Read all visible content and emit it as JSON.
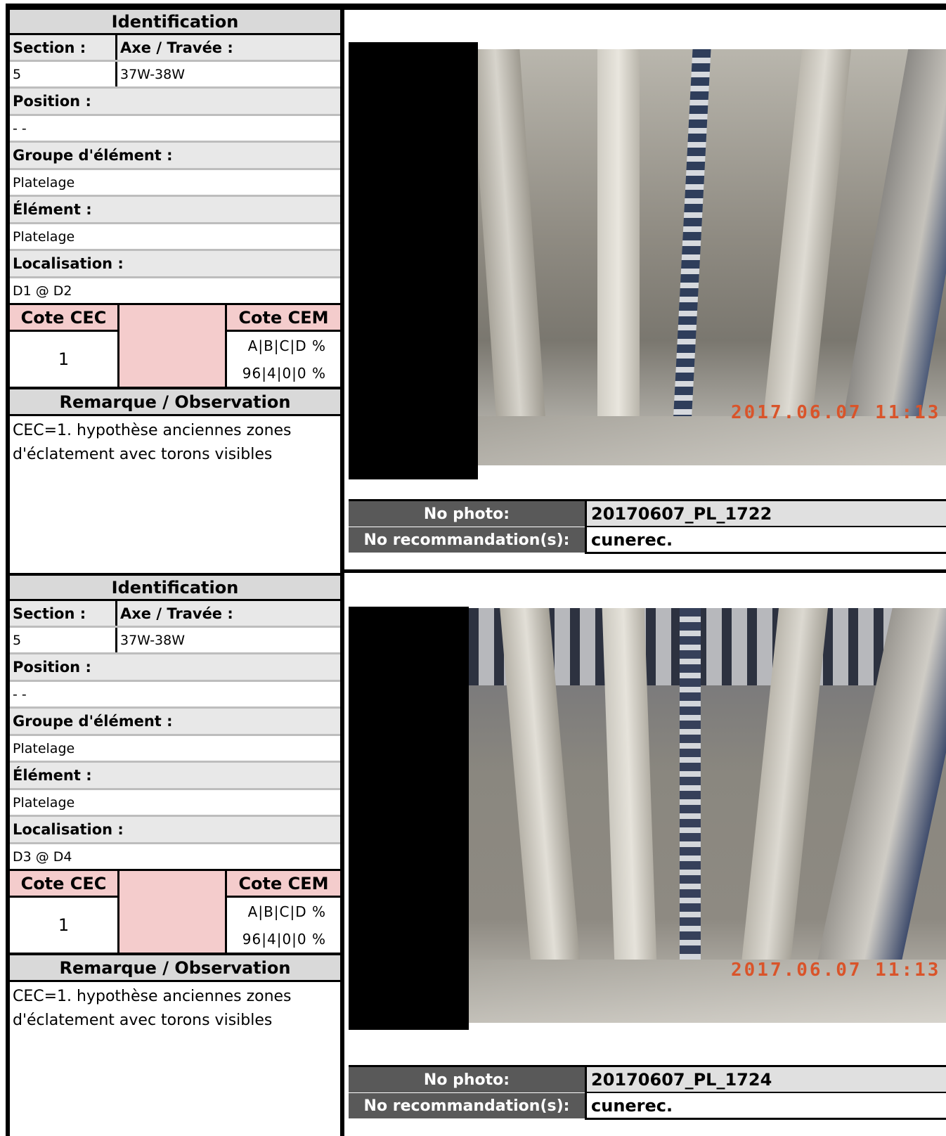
{
  "labels": {
    "identification": "Identification",
    "section": "Section :",
    "axe_travee": "Axe / Travée :",
    "position": "Position :",
    "groupe": "Groupe d'élément :",
    "element": "Élément :",
    "localisation": "Localisation :",
    "cote_cec": "Cote CEC",
    "cote_cem": "Cote CEM",
    "cem_header": "A|B|C|D %",
    "remarque": "Remarque / Observation",
    "no_photo": "No photo:",
    "no_recommandation": "No recommandation(s):"
  },
  "records": [
    {
      "section": "5",
      "axe": "37W-38W",
      "position": "- -",
      "groupe": "Platelage",
      "element": "Platelage",
      "localisation": "D1 @ D2",
      "cec": "1",
      "cem": "96|4|0|0 %",
      "remarque_line1": "CEC=1. hypothèse anciennes zones",
      "remarque_line2": "d'éclatement avec torons visibles",
      "timestamp": "2017.06.07 11:13",
      "photo_no": "20170607_PL_1722",
      "recommandation": "cunerec."
    },
    {
      "section": "5",
      "axe": "37W-38W",
      "position": "- -",
      "groupe": "Platelage",
      "element": "Platelage",
      "localisation": "D3 @ D4",
      "cec": "1",
      "cem": "96|4|0|0 %",
      "remarque_line1": "CEC=1. hypothèse anciennes zones",
      "remarque_line2": "d'éclatement avec torons visibles",
      "timestamp": "2017.06.07 11:13",
      "photo_no": "20170607_PL_1724",
      "recommandation": "cunerec."
    }
  ],
  "colors": {
    "header_gray": "#d9d9d9",
    "pink": "#f4cccc",
    "meta_label_bg": "#595959",
    "stamp": "#d9542a"
  }
}
